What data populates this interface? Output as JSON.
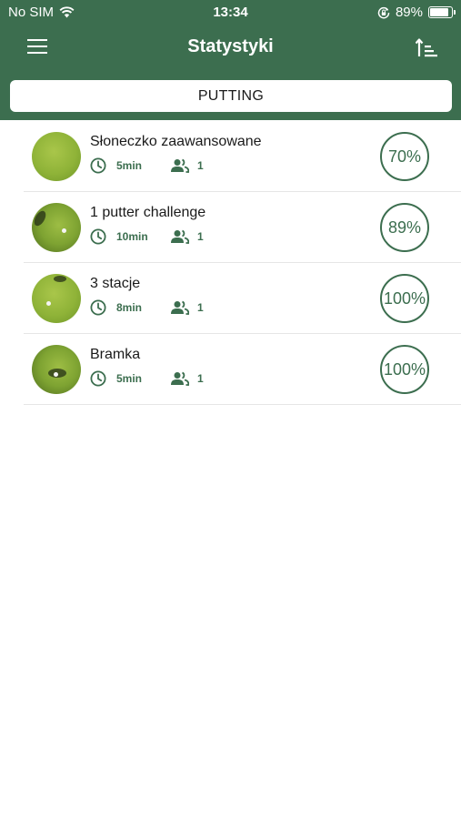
{
  "status_bar": {
    "carrier": "No SIM",
    "time": "13:34",
    "battery": "89%",
    "battery_level": 0.89
  },
  "header": {
    "title": "Statystyki",
    "menu_icon": "hamburger-menu-icon",
    "sort_icon": "sort-ascending-icon"
  },
  "tab": {
    "label": "PUTTING"
  },
  "items": [
    {
      "title": "Słoneczko zaawansowane",
      "duration": "5min",
      "players": "1",
      "score": "70%"
    },
    {
      "title": "1 putter challenge",
      "duration": "10min",
      "players": "1",
      "score": "89%"
    },
    {
      "title": "3 stacje",
      "duration": "8min",
      "players": "1",
      "score": "100%"
    },
    {
      "title": "Bramka",
      "duration": "5min",
      "players": "1",
      "score": "100%"
    }
  ],
  "colors": {
    "primary": "#3c6e4f",
    "background": "#ffffff",
    "divider": "#e6e6e6"
  }
}
